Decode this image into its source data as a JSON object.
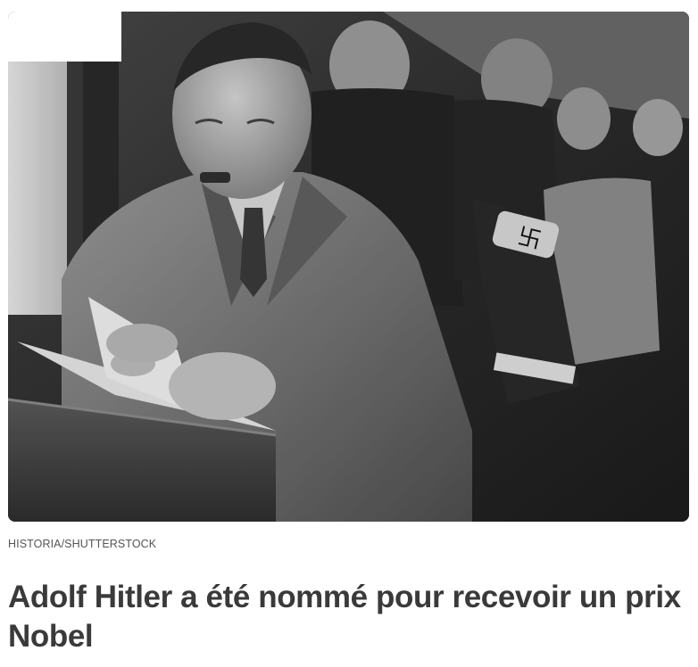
{
  "article": {
    "image": {
      "alt": "Adolf Hitler reading a book while seated by a window on an airplane",
      "credit": "HISTORIA/SHUTTERSTOCK"
    },
    "title": "Adolf Hitler a été nommé pour recevoir un prix Nobel"
  },
  "colors": {
    "headline": "#3a3a3a",
    "credit": "#555555",
    "background": "#ffffff"
  }
}
